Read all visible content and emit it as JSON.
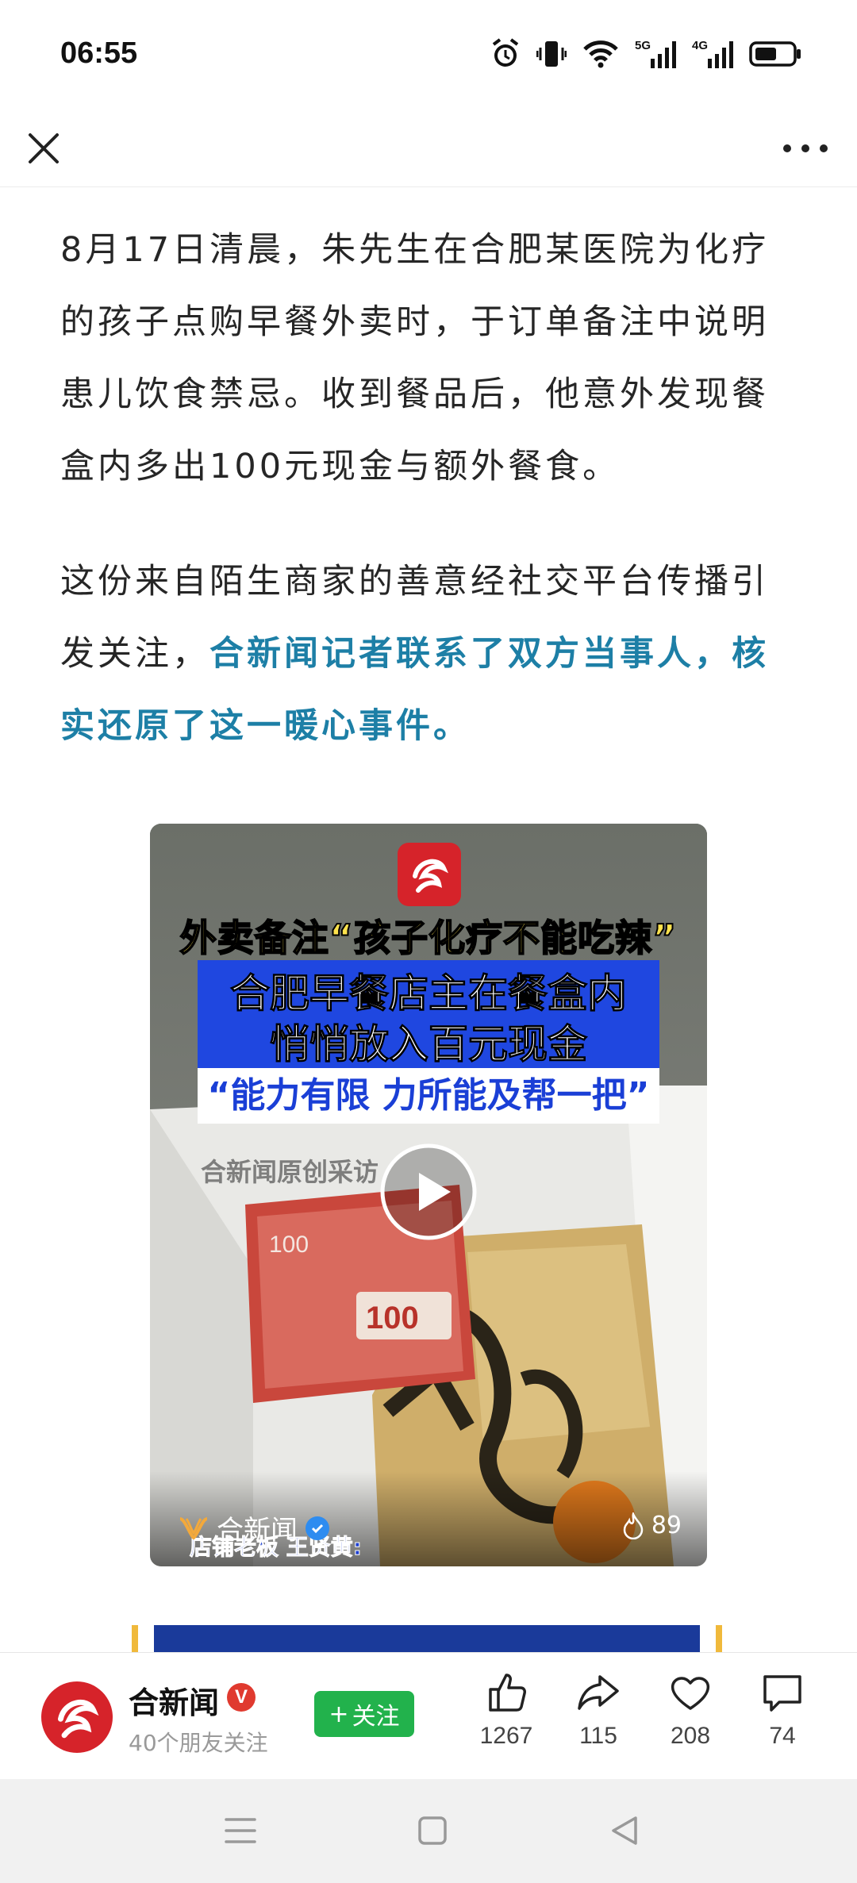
{
  "status_bar": {
    "time": "06:55",
    "icons": [
      "alarm-icon",
      "vibrate-icon",
      "wifi-icon",
      "5g-signal-icon",
      "4g-signal-icon",
      "battery-icon"
    ],
    "net1": "5G",
    "net2": "4G"
  },
  "nav": {
    "close_icon": "close-icon",
    "more_icon": "more-icon"
  },
  "article": {
    "para1": "8月17日清晨，朱先生在合肥某医院为化疗的孩子点购早餐外卖时，于订单备注中说明患儿饮食禁忌。收到餐品后，他意外发现餐盒内多出100元现金与额外餐食。",
    "para2_plain": "这份来自陌生商家的善意经社交平台传播引发关注，",
    "para2_highlight": "合新闻记者联系了双方当事人，核实还原了这一暖心事件。"
  },
  "video": {
    "headline_yellow": "外卖备注“孩子化疗不能吃辣”",
    "headline_blue_line1": "合肥早餐店主在餐盒内",
    "headline_blue_line2": "悄悄放入百元现金",
    "headline_quote": "“能力有限 力所能及帮一把”",
    "watermark": "合新闻原创采访",
    "source_name": "合新闻",
    "caption": "店铺老板 王贤黄:",
    "likes": "89",
    "colors": {
      "yellow": "#ffe34d",
      "blue": "#1f47e0",
      "brand_red": "#d6232a"
    }
  },
  "action_bar": {
    "author_name": "合新闻",
    "author_badge": "V",
    "friends_follow": "40个朋友关注",
    "follow_label": "关注",
    "like_count": "1267",
    "share_count": "115",
    "favorite_count": "208",
    "comment_count": "74"
  },
  "system_nav": {
    "buttons": [
      "menu-icon",
      "home-icon",
      "back-icon"
    ]
  }
}
